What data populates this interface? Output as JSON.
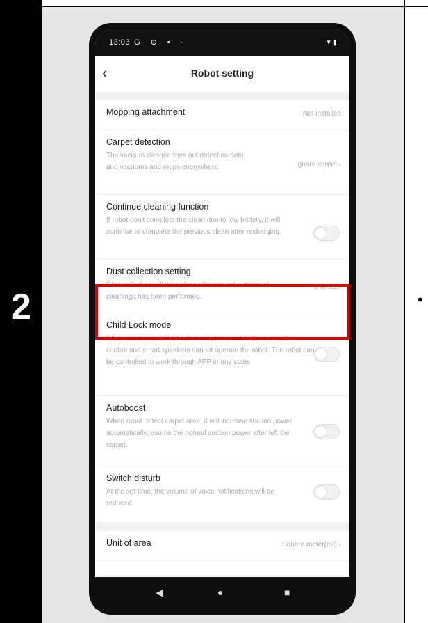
{
  "step": {
    "number": "2"
  },
  "status_bar": {
    "time": "13:03",
    "left_icons": "G ⊕ ▪ ·",
    "right_icons": "▾ ▮"
  },
  "appbar": {
    "title": "Robot setting",
    "back_icon": "chevron-left-icon"
  },
  "settings": {
    "mopping": {
      "title": "Mopping attachment",
      "value": "Not installed"
    },
    "carpet": {
      "title": "Carpet detection",
      "desc": "The vacuum cleaner does not detect carpets and vacuums and mops everywhere.",
      "value": "Ignore carpet"
    },
    "continue": {
      "title": "Continue cleaning function",
      "desc": "If robot don't complete the clean due to low battery, it will continue to complete the previous clean after recharging.",
      "toggle": false
    },
    "dust": {
      "title": "Dust collection setting",
      "desc": "Dust collection will take place after the set number of cleanings has been performed.",
      "value": "5 times"
    },
    "childlock": {
      "title": "Child Lock mode",
      "desc": "When robot is at Child Lock mode, the robot buttons, remote control and smart speakers cannot operate the robot. The robot can be controlled to work through APP in any state.",
      "toggle": false
    },
    "autoboost": {
      "title": "Autoboost",
      "desc": "When robot detect carpet area, it will increase suction power automatically,resume the normal suction power after left the carpet.",
      "toggle": false
    },
    "disturb": {
      "title": "Switch disturb",
      "desc": "At the set time, the volume of voice notifications will be reduced",
      "toggle": false
    },
    "unit": {
      "title": "Unit of area",
      "value": "Square meter(m²)"
    }
  },
  "chevron": "›",
  "navbar": {
    "back": "◀",
    "home": "●",
    "recents": "■"
  },
  "colors": {
    "highlight": "#e00000",
    "panel": "#e6e6e6",
    "phone": "#0d0d0d"
  }
}
